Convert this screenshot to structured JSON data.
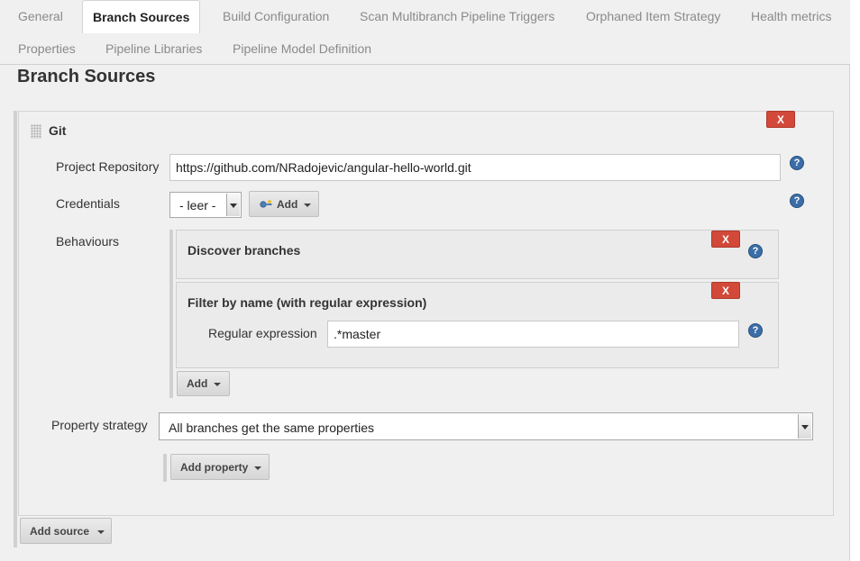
{
  "tabs": [
    {
      "label": "General"
    },
    {
      "label": "Branch Sources",
      "active": true
    },
    {
      "label": "Build Configuration"
    },
    {
      "label": "Scan Multibranch Pipeline Triggers"
    },
    {
      "label": "Orphaned Item Strategy"
    },
    {
      "label": "Health metrics"
    },
    {
      "label": "Properties"
    },
    {
      "label": "Pipeline Libraries"
    },
    {
      "label": "Pipeline Model Definition"
    }
  ],
  "section_title": "Branch Sources",
  "source": {
    "title": "Git",
    "delete_label": "X",
    "project_repository": {
      "label": "Project Repository",
      "value": "https://github.com/NRadojevic/angular-hello-world.git"
    },
    "credentials": {
      "label": "Credentials",
      "selected": "- leer -",
      "add_label": "Add"
    },
    "behaviours": {
      "label": "Behaviours",
      "items": [
        {
          "title": "Discover branches",
          "delete_label": "X"
        },
        {
          "title": "Filter by name (with regular expression)",
          "delete_label": "X",
          "field": {
            "label": "Regular expression",
            "value": ".*master"
          }
        }
      ],
      "add_label": "Add"
    },
    "property_strategy": {
      "label": "Property strategy",
      "selected": "All branches get the same properties"
    },
    "add_property_label": "Add property"
  },
  "add_source_label": "Add source",
  "help_glyph": "?",
  "colors": {
    "delete": "#d24939",
    "help": "#3b6ea8",
    "background": "#f0f0f0"
  }
}
